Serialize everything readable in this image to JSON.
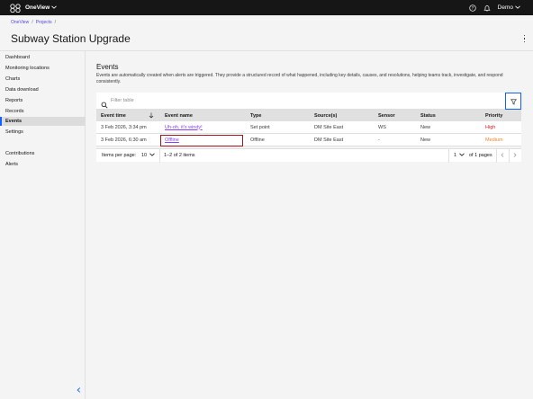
{
  "topbar": {
    "app_name": "OneView",
    "user_name": "Demo"
  },
  "breadcrumb": {
    "items": [
      "OneView",
      "Projects"
    ],
    "separator": "/"
  },
  "page": {
    "title": "Subway Station Upgrade"
  },
  "sidebar": {
    "items": [
      {
        "label": "Dashboard"
      },
      {
        "label": "Monitoring locations"
      },
      {
        "label": "Charts"
      },
      {
        "label": "Data download"
      },
      {
        "label": "Reports"
      },
      {
        "label": "Records"
      },
      {
        "label": "Events"
      },
      {
        "label": "Settings"
      },
      {
        "label": "Contributions"
      },
      {
        "label": "Alerts"
      }
    ],
    "active": "Events"
  },
  "events": {
    "title": "Events",
    "description": "Events are automatically created when alerts are triggered. They provide a structured record of what happened, including key details, causes, and resolutions, helping teams track, investigate, and respond consistently.",
    "search_placeholder": "Filter table",
    "columns": [
      "Event time",
      "Event name",
      "Type",
      "Source(s)",
      "Sensor",
      "Status",
      "Priority"
    ],
    "rows": [
      {
        "time": "3 Feb 2026, 3:34 pm",
        "name": "Uh-oh, it's windy!",
        "type": "Set point",
        "source": "DM Site East",
        "sensor": "WS",
        "status": "New",
        "priority": "High"
      },
      {
        "time": "3 Feb 2026, 6:30 am",
        "name": "Offline",
        "type": "Offline",
        "source": "DM Site East",
        "sensor": "-",
        "status": "New",
        "priority": "Medium"
      }
    ]
  },
  "pagination": {
    "items_per_page_label": "Items per page:",
    "items_per_page": "10",
    "range": "1–2 of 2 items",
    "page": "1",
    "of_pages": "of 1 pages"
  },
  "colors": {
    "accent": "#0f62fe",
    "link": "#8a3ffc",
    "high": "#da1e28",
    "medium": "#ff832b",
    "highlight": "#b0121b"
  }
}
